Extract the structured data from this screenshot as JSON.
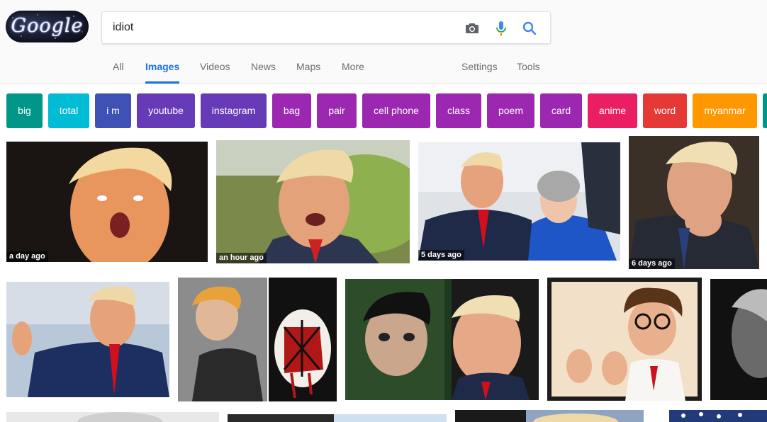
{
  "logo": {
    "text": "Google"
  },
  "search": {
    "query": "idiot"
  },
  "tabs": [
    {
      "label": "All",
      "active": false
    },
    {
      "label": "Images",
      "active": true
    },
    {
      "label": "Videos",
      "active": false
    },
    {
      "label": "News",
      "active": false
    },
    {
      "label": "Maps",
      "active": false
    },
    {
      "label": "More",
      "active": false
    },
    {
      "label": "Settings",
      "active": false
    },
    {
      "label": "Tools",
      "active": false
    }
  ],
  "chips": [
    {
      "label": "big",
      "color": "#009688"
    },
    {
      "label": "total",
      "color": "#00bcd4"
    },
    {
      "label": "i m",
      "color": "#3f51b5"
    },
    {
      "label": "youtube",
      "color": "#673ab7"
    },
    {
      "label": "instagram",
      "color": "#673ab7"
    },
    {
      "label": "bag",
      "color": "#9c27b0"
    },
    {
      "label": "pair",
      "color": "#9c27b0"
    },
    {
      "label": "cell phone",
      "color": "#9c27b0"
    },
    {
      "label": "class",
      "color": "#9c27b0"
    },
    {
      "label": "poem",
      "color": "#9c27b0"
    },
    {
      "label": "card",
      "color": "#9c27b0"
    },
    {
      "label": "anime",
      "color": "#e91e63"
    },
    {
      "label": "word",
      "color": "#e53935"
    },
    {
      "label": "myanmar",
      "color": "#ff9800"
    },
    {
      "label": "",
      "color": "#009688"
    }
  ],
  "images": [
    {
      "badge": "a day ago",
      "subject": "man-open-mouth"
    },
    {
      "badge": "an hour ago",
      "subject": "man-shouting-outdoors"
    },
    {
      "badge": "5 days ago",
      "subject": "man-and-woman-smiling"
    },
    {
      "badge": "6 days ago",
      "subject": "man-hand-on-chin"
    },
    {
      "badge": "",
      "subject": "man-in-suit-waving"
    },
    {
      "badge": "",
      "subject": "punk-singer-and-grenade-art"
    },
    {
      "badge": "",
      "subject": "punk-singer-and-man-side-by-side"
    },
    {
      "badge": "",
      "subject": "man-with-glasses-thumbs-up"
    },
    {
      "badge": "",
      "subject": "man-black-and-white"
    },
    {
      "badge": "",
      "subject": "partial-row-image"
    },
    {
      "badge": "",
      "subject": "partial-row-image"
    },
    {
      "badge": "",
      "subject": "partial-row-image"
    },
    {
      "badge": "",
      "subject": "partial-row-image"
    }
  ],
  "colors": {
    "accent": "#1a73e8",
    "tab_text": "#6d6d6d",
    "header_bg": "#fafafa"
  },
  "icons": [
    "camera-icon",
    "mic-icon",
    "search-icon"
  ]
}
